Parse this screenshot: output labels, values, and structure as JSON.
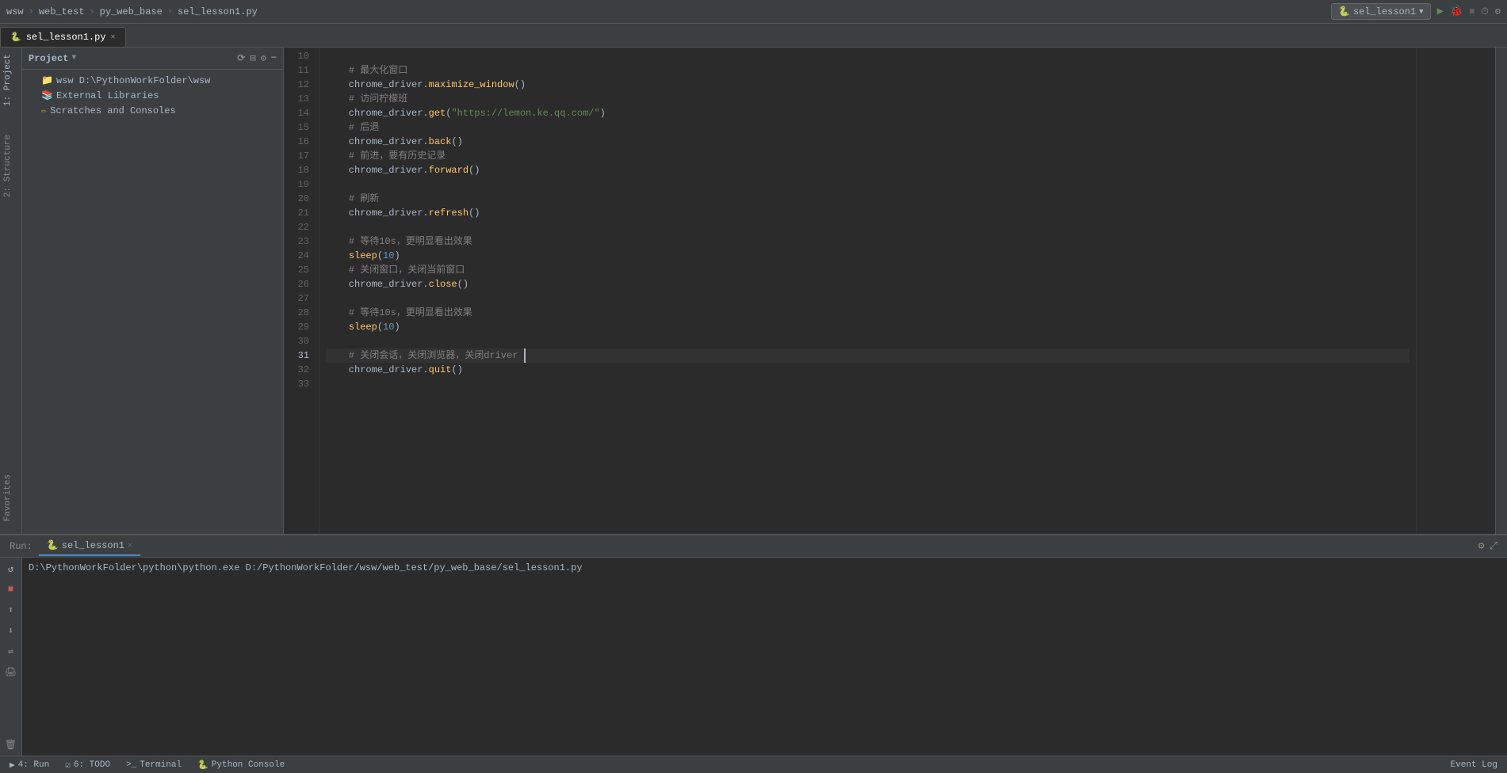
{
  "topbar": {
    "breadcrumbs": [
      "wsw",
      "web_test",
      "py_web_base",
      "sel_lesson1.py"
    ],
    "run_config": "sel_lesson1",
    "icons": [
      "run-icon",
      "debug-icon",
      "coverage-icon",
      "profile-icon",
      "settings-icon"
    ]
  },
  "tabs": [
    {
      "label": "sel_lesson1.py",
      "active": true,
      "icon": "🐍"
    }
  ],
  "project": {
    "title": "Project",
    "items": [
      {
        "label": "wsw  D:\\PythonWorkFolder\\wsw",
        "type": "folder",
        "indent": 1
      },
      {
        "label": "External Libraries",
        "type": "library",
        "indent": 1
      },
      {
        "label": "Scratches and Consoles",
        "type": "scratch",
        "indent": 1
      }
    ]
  },
  "left_tabs": [
    "1: Project",
    "2: Structure",
    "Favorites"
  ],
  "code": {
    "lines": [
      {
        "num": 10,
        "content": ""
      },
      {
        "num": 11,
        "content": "    # 最大化窗口",
        "type": "comment"
      },
      {
        "num": 12,
        "content": "    chrome_driver.maximize_window()",
        "type": "code"
      },
      {
        "num": 13,
        "content": "    # 访问柠檬班",
        "type": "comment"
      },
      {
        "num": 14,
        "content": "    chrome_driver.get(\"https://lemon.ke.qq.com/\")",
        "type": "code"
      },
      {
        "num": 15,
        "content": "    # 后退",
        "type": "comment"
      },
      {
        "num": 16,
        "content": "    chrome_driver.back()",
        "type": "code"
      },
      {
        "num": 17,
        "content": "    # 前进，要有历史记录",
        "type": "comment"
      },
      {
        "num": 18,
        "content": "    chrome_driver.forward()",
        "type": "code"
      },
      {
        "num": 19,
        "content": ""
      },
      {
        "num": 20,
        "content": "    # 刷新",
        "type": "comment"
      },
      {
        "num": 21,
        "content": "    chrome_driver.refresh()",
        "type": "code"
      },
      {
        "num": 22,
        "content": ""
      },
      {
        "num": 23,
        "content": "    # 等待10s，更明显看出效果",
        "type": "comment"
      },
      {
        "num": 24,
        "content": "    sleep(10)",
        "type": "code"
      },
      {
        "num": 25,
        "content": "    # 关闭窗口，关闭当前窗口",
        "type": "comment"
      },
      {
        "num": 26,
        "content": "    chrome_driver.close()",
        "type": "code"
      },
      {
        "num": 27,
        "content": ""
      },
      {
        "num": 28,
        "content": "    # 等待10s，更明显看出效果",
        "type": "comment"
      },
      {
        "num": 29,
        "content": "    sleep(10)",
        "type": "code"
      },
      {
        "num": 30,
        "content": ""
      },
      {
        "num": 31,
        "content": "    # 关闭会话，关闭浏览器，关闭driver",
        "type": "comment",
        "current": true
      },
      {
        "num": 32,
        "content": "    chrome_driver.quit()",
        "type": "code"
      },
      {
        "num": 33,
        "content": ""
      }
    ]
  },
  "run_panel": {
    "tab_label": "sel_lesson1",
    "command": "D:\\PythonWorkFolder\\python\\python.exe D:/PythonWorkFolder/wsw/web_test/py_web_base/sel_lesson1.py",
    "icons": [
      "rerun-icon",
      "stop-icon",
      "scroll-up-icon",
      "scroll-down-icon",
      "soft-wrap-icon",
      "print-icon",
      "clear-icon"
    ]
  },
  "status_bar": {
    "run_label": "4: Run",
    "todo_label": "6: TODO",
    "terminal_label": "Terminal",
    "python_console_label": "Python Console",
    "event_log_label": "Event Log",
    "run_icon": "▶",
    "todo_icon": "☑",
    "terminal_icon": ">_",
    "python_icon": "🐍"
  }
}
